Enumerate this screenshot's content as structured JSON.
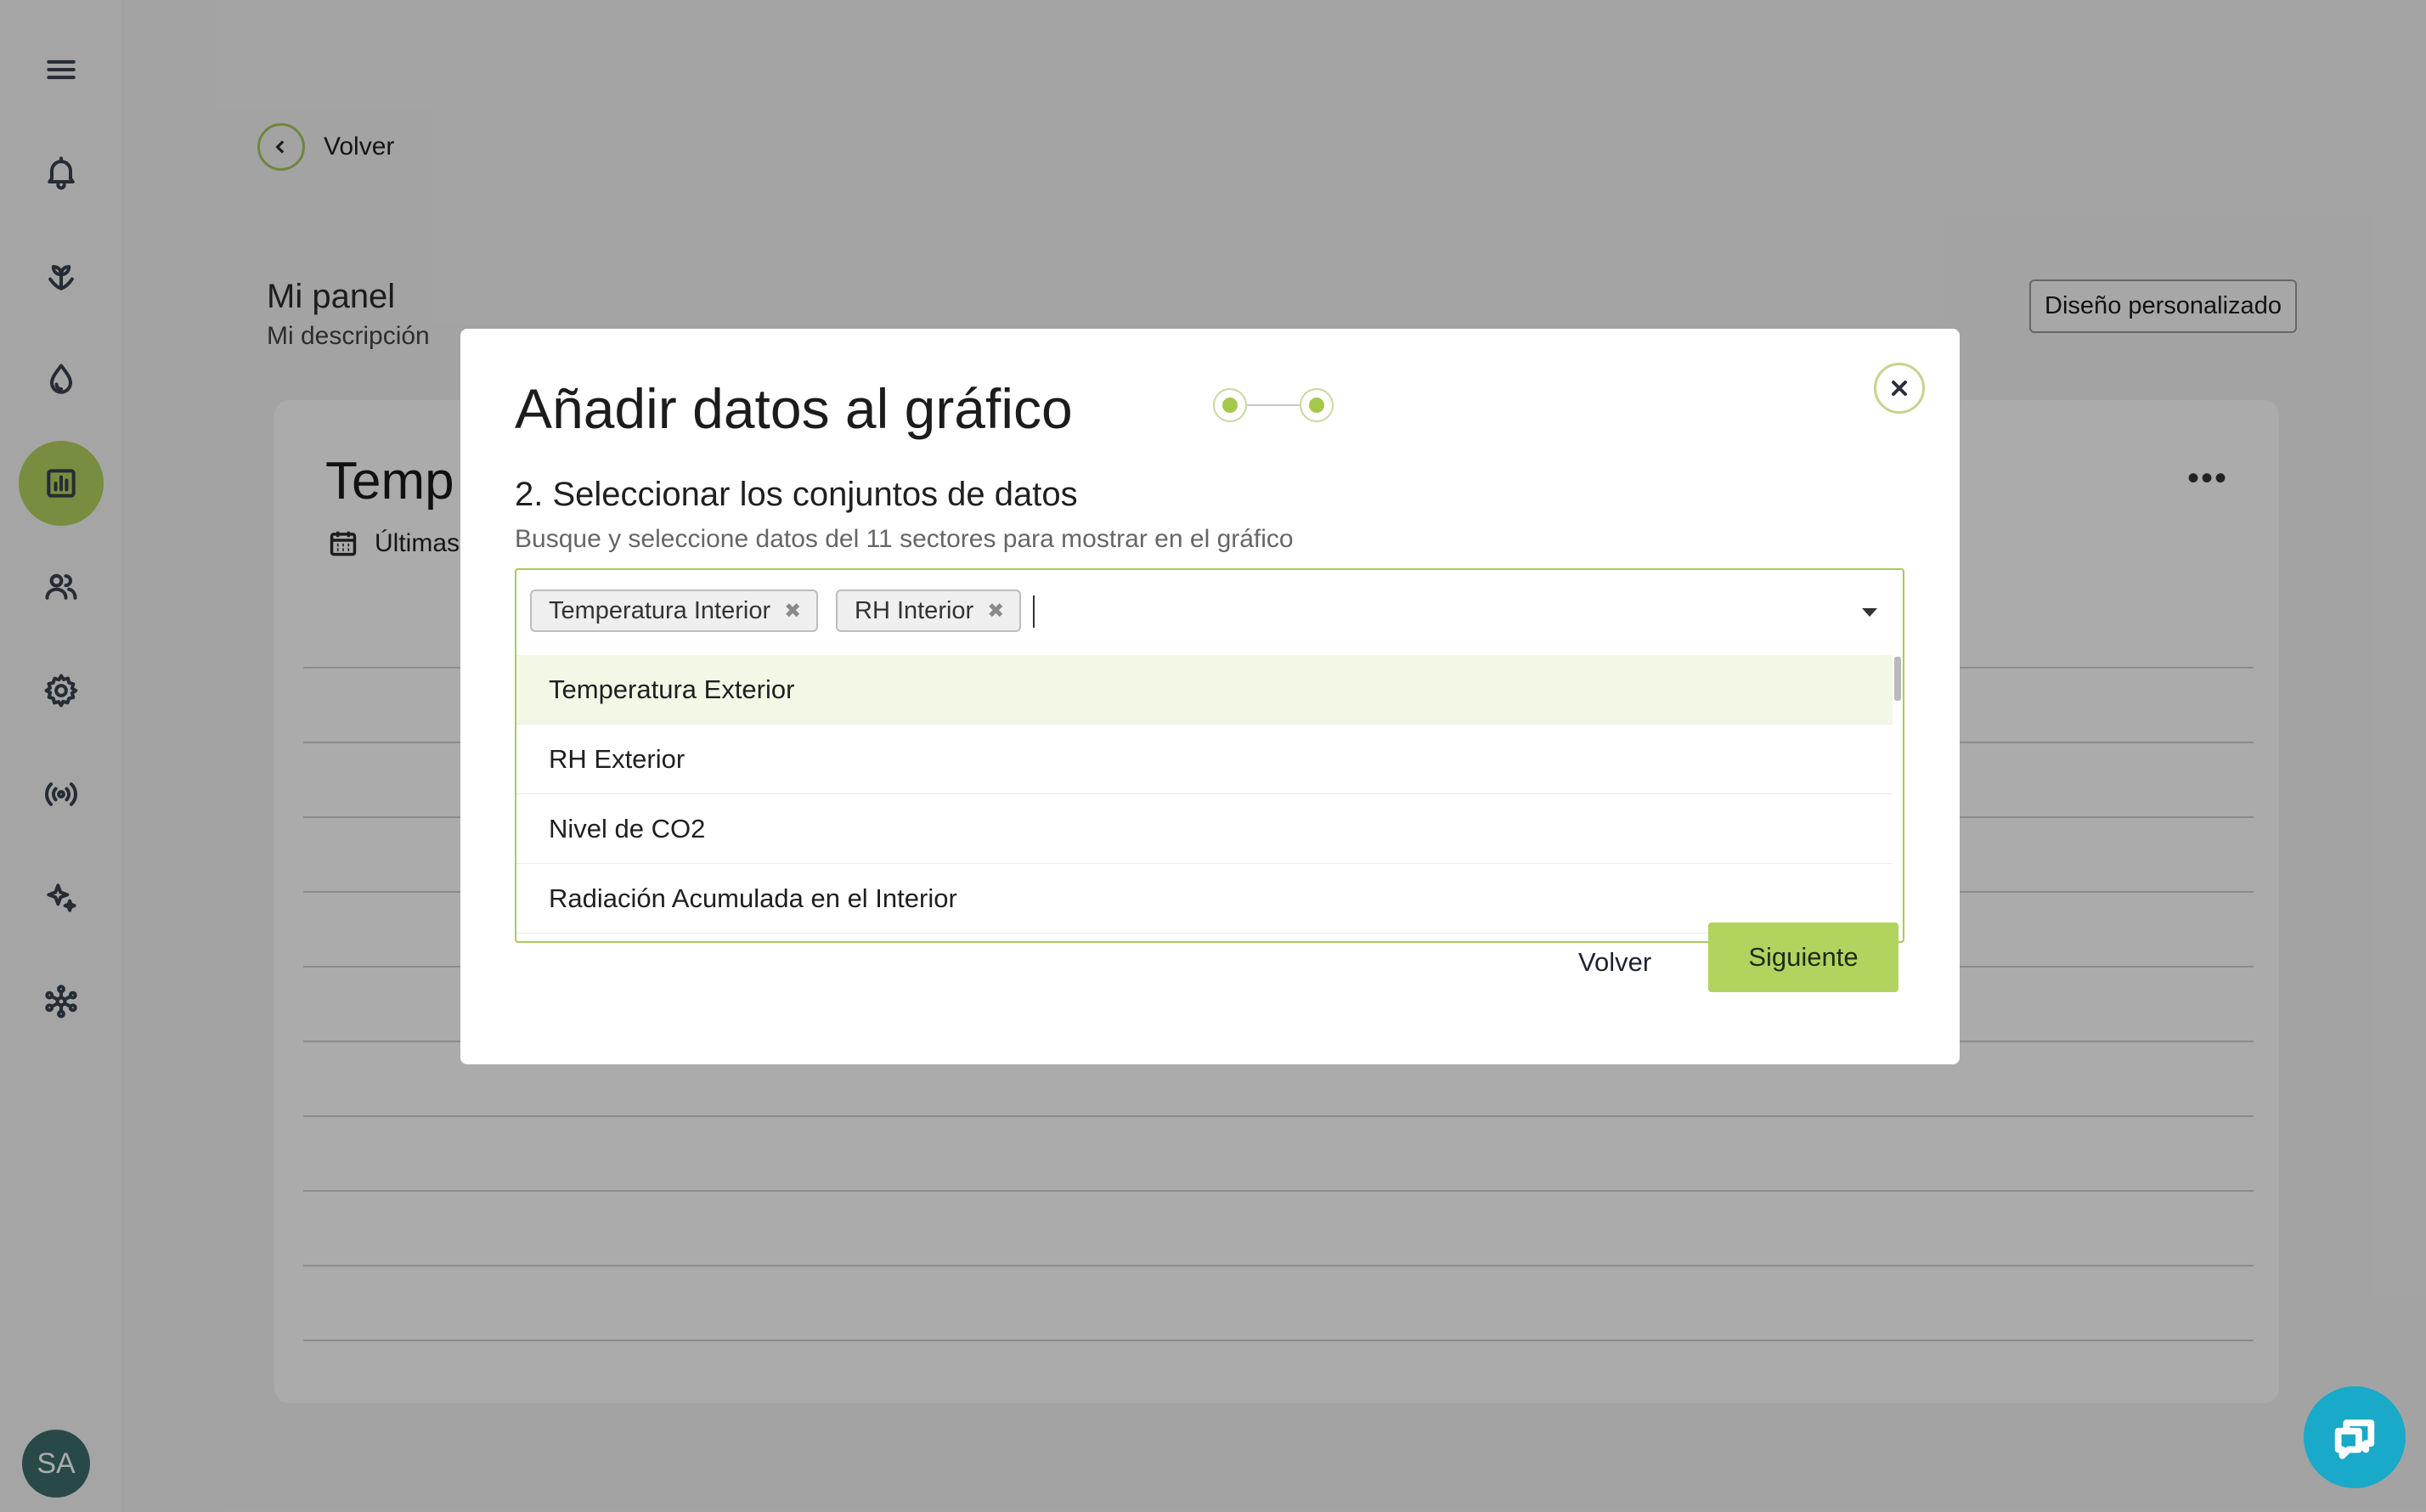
{
  "nav": {
    "items": [
      {
        "icon": "menu-icon"
      },
      {
        "icon": "bell-icon"
      },
      {
        "icon": "plant-icon"
      },
      {
        "icon": "drop-icon"
      },
      {
        "icon": "chart-icon",
        "active": true
      },
      {
        "icon": "users-icon"
      },
      {
        "icon": "gear-icon"
      },
      {
        "icon": "broadcast-icon"
      },
      {
        "icon": "sparkles-icon"
      },
      {
        "icon": "network-icon"
      }
    ],
    "avatar_initials": "SA"
  },
  "page": {
    "back_label": "Volver",
    "panel_title": "Mi panel",
    "panel_description": "Mi descripción",
    "custom_design_label": "Diseño personalizado",
    "card_title": "Temp",
    "card_subtitle": "Últimas",
    "card_menu": "•••"
  },
  "modal": {
    "title": "Añadir datos al gráfico",
    "step_heading": "2. Seleccionar los conjuntos de datos",
    "step_help": "Busque y seleccione datos del 11 sectores para mostrar en el gráfico",
    "selected_chips": [
      "Temperatura Interior",
      "RH Interior"
    ],
    "chip_remove_symbol": "✖",
    "options": [
      "Temperatura Exterior",
      "RH Exterior",
      "Nivel de CO2",
      "Radiación Acumulada en el Interior"
    ],
    "back_label": "Volver",
    "next_label": "Siguiente"
  },
  "colors": {
    "accent": "#b2d35e",
    "chat_button": "#19a9c9",
    "avatar": "#3c6e6c"
  }
}
